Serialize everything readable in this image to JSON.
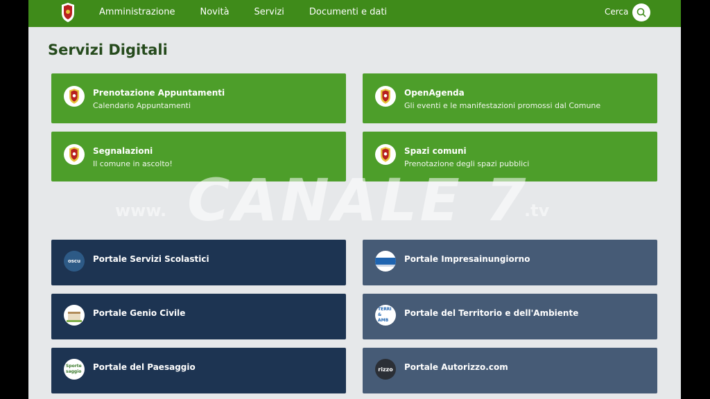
{
  "header": {
    "nav": [
      "Amministrazione",
      "Novità",
      "Servizi",
      "Documenti e dati"
    ],
    "search_label": "Cerca"
  },
  "page_title": "Servizi Digitali",
  "digital_services": [
    {
      "title": "Prenotazione Appuntamenti",
      "subtitle": "Calendario Appuntamenti",
      "icon": "municipal-crest-icon"
    },
    {
      "title": "OpenAgenda",
      "subtitle": "Gli eventi e le manifestazioni promossi dal Comune",
      "icon": "municipal-crest-icon"
    },
    {
      "title": "Segnalazioni",
      "subtitle": "Il comune in ascolto!",
      "icon": "municipal-crest-icon"
    },
    {
      "title": "Spazi comuni",
      "subtitle": "Prenotazione degli spazi pubblici",
      "icon": "municipal-crest-icon"
    }
  ],
  "portals": [
    {
      "title": "Portale Servizi Scolastici",
      "icon_text": "oscu",
      "icon": "school-services-logo-icon"
    },
    {
      "title": "Portale Impresainungiorno",
      "icon_text": "",
      "icon": "impresa-logo-icon"
    },
    {
      "title": "Portale Genio Civile",
      "icon_text": "",
      "icon": "building-icon"
    },
    {
      "title": "Portale del Territorio e dell'Ambiente",
      "icon_text": "TERRI & AMB",
      "icon": "territory-logo-icon"
    },
    {
      "title": "Portale del Paesaggio",
      "icon_text": "Sporte saggio",
      "icon": "landscape-logo-icon"
    },
    {
      "title": "Portale Autorizzo.com",
      "icon_text": "rizzo",
      "icon": "autorizzo-logo-icon"
    }
  ],
  "watermark": {
    "main": "CANALE 7",
    "prefix": "www.",
    "suffix": ".tv"
  },
  "colors": {
    "header_green": "#3f8b1a",
    "card_green": "#4d9e2a",
    "card_dark": "#1d3452",
    "card_slate": "#465b76",
    "title_green": "#254a1c"
  }
}
